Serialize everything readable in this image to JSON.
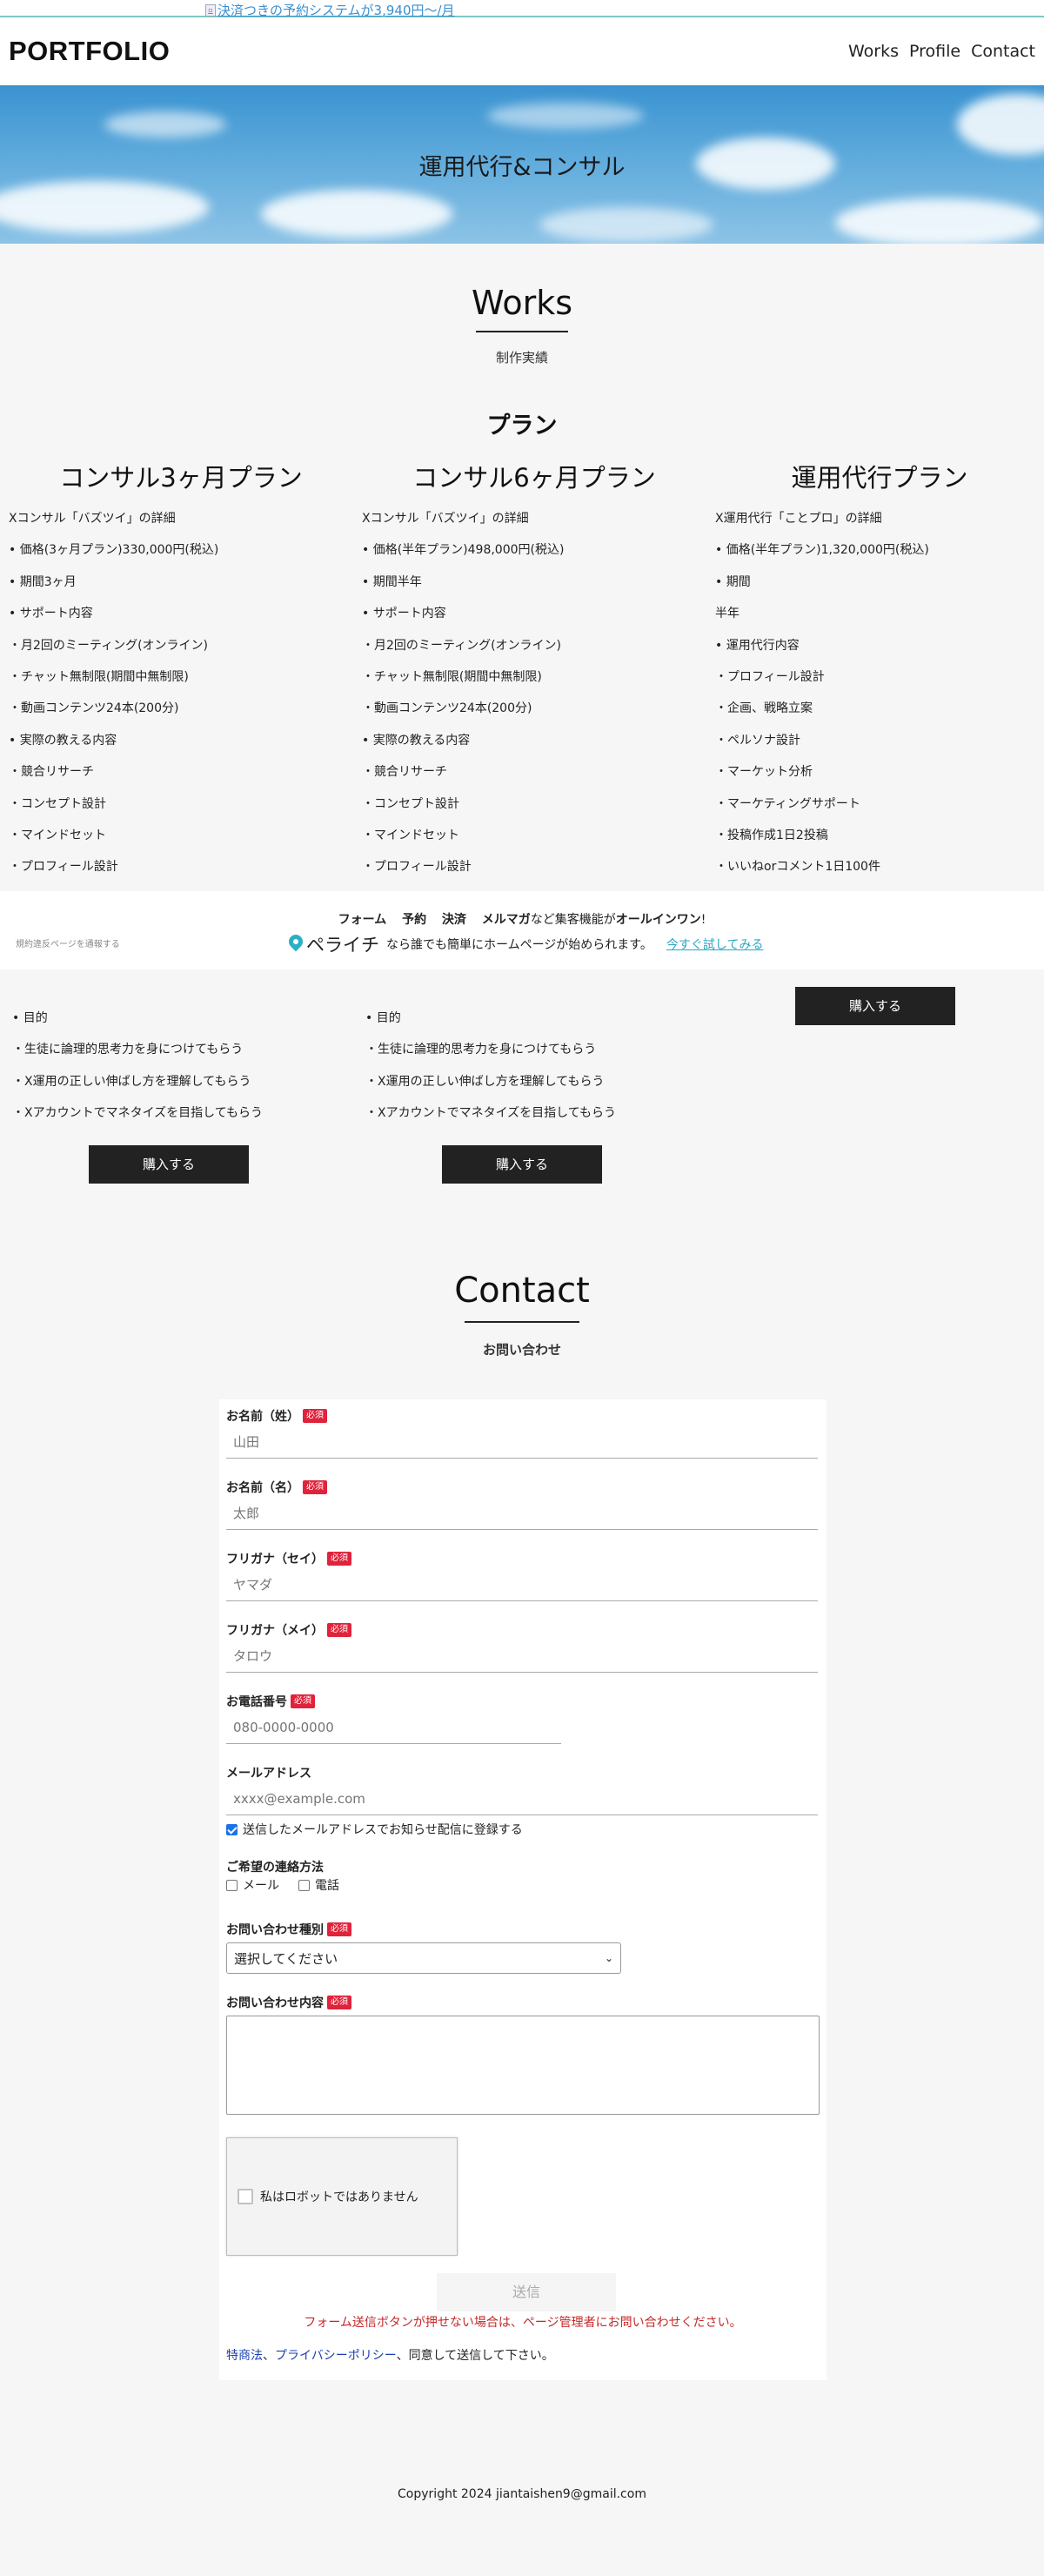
{
  "promo": {
    "link_text": "決済つきの予約システムが3,940円〜/月"
  },
  "header": {
    "logo": "PORTFOLIO",
    "nav": [
      "Works",
      "Profile",
      "Contact"
    ]
  },
  "hero": {
    "title": "運用代行&コンサル"
  },
  "works": {
    "title": "Works",
    "subtitle": "制作実績",
    "plan_heading": "プラン",
    "plans": [
      {
        "title": "コンサル3ヶ月プラン",
        "items": [
          "Xコンサル「バズツイ」の詳細",
          "• 価格(3ヶ月プラン)330,000円(税込)",
          "• 期間3ヶ月",
          "• サポート内容",
          "・月2回のミーティング(オンライン)",
          "・チャット無制限(期間中無制限)",
          "・動画コンテンツ24本(200分)",
          "• 実際の教える内容",
          "・競合リサーチ",
          "・コンセプト設計",
          "・マインドセット",
          "・プロフィール設計"
        ],
        "lower_items": [
          "• 目的",
          "・生徒に論理的思考力を身につけてもらう",
          "・X運用の正しい伸ばし方を理解してもらう",
          "・Xアカウントでマネタイズを目指してもらう"
        ],
        "buy_label": "購入する"
      },
      {
        "title": "コンサル6ヶ月プラン",
        "items": [
          "Xコンサル「バズツイ」の詳細",
          "• 価格(半年プラン)498,000円(税込)",
          "• 期間半年",
          "• サポート内容",
          "・月2回のミーティング(オンライン)",
          "・チャット無制限(期間中無制限)",
          "・動画コンテンツ24本(200分)",
          "• 実際の教える内容",
          "・競合リサーチ",
          "・コンセプト設計",
          "・マインドセット",
          "・プロフィール設計"
        ],
        "lower_items": [
          "• 目的",
          "・生徒に論理的思考力を身につけてもらう",
          "・X運用の正しい伸ばし方を理解してもらう",
          "・Xアカウントでマネタイズを目指してもらう"
        ],
        "buy_label": "購入する"
      },
      {
        "title": "運用代行プラン",
        "items": [
          "X運用代行「ことプロ」の詳細",
          "• 価格(半年プラン)1,320,000円(税込)",
          "• 期間",
          "半年",
          "• 運用代行内容",
          "・プロフィール設計",
          "・企画、戦略立案",
          "・ペルソナ設計",
          "・マーケット分析",
          "・マーケティングサポート",
          "・投稿作成1日2投稿",
          "・いいねorコメント1日100件"
        ],
        "buy_label": "購入する"
      }
    ]
  },
  "ad": {
    "report": "規約違反ページを通報する",
    "line1_parts": [
      "フォーム",
      "予約",
      "決済",
      "メルマガ",
      "など集客機能が",
      "オールインワン",
      "!"
    ],
    "brand": "ペライチ",
    "line2": "なら誰でも簡単にホームページが始められます。",
    "cta": "今すぐ試してみる"
  },
  "contact": {
    "title": "Contact",
    "subtitle": "お問い合わせ",
    "required_label": "必須",
    "fields": {
      "last_name": {
        "label": "お名前（姓）",
        "placeholder": "山田"
      },
      "first_name": {
        "label": "お名前（名）",
        "placeholder": "太郎"
      },
      "kana_last": {
        "label": "フリガナ（セイ）",
        "placeholder": "ヤマダ"
      },
      "kana_first": {
        "label": "フリガナ（メイ）",
        "placeholder": "タロウ"
      },
      "phone": {
        "label": "お電話番号",
        "placeholder": "080-0000-0000"
      },
      "email": {
        "label": "メールアドレス",
        "placeholder": "xxxx@example.com"
      }
    },
    "newsletter": "送信したメールアドレスでお知らせ配信に登録する",
    "contact_method": {
      "label": "ご希望の連絡方法",
      "options": [
        "メール",
        "電話"
      ]
    },
    "inquiry_type": {
      "label": "お問い合わせ種別",
      "selected": "選択してください"
    },
    "inquiry_body": {
      "label": "お問い合わせ内容"
    },
    "recaptcha": "私はロボットではありません",
    "submit": "送信",
    "warning": "フォーム送信ボタンが押せない場合は、ページ管理者にお問い合わせください。",
    "policy": {
      "link1": "特商法",
      "sep": "、",
      "link2": "プライバシーポリシー",
      "rest": "、同意して送信して下さい。"
    }
  },
  "footer": {
    "copyright": "Copyright 2024 jiantaishen9@gmail.com"
  },
  "colors": {
    "accent": "#7ec9c4",
    "dark_button": "#222222",
    "required": "#e0233b",
    "link": "#2aa6c0"
  }
}
